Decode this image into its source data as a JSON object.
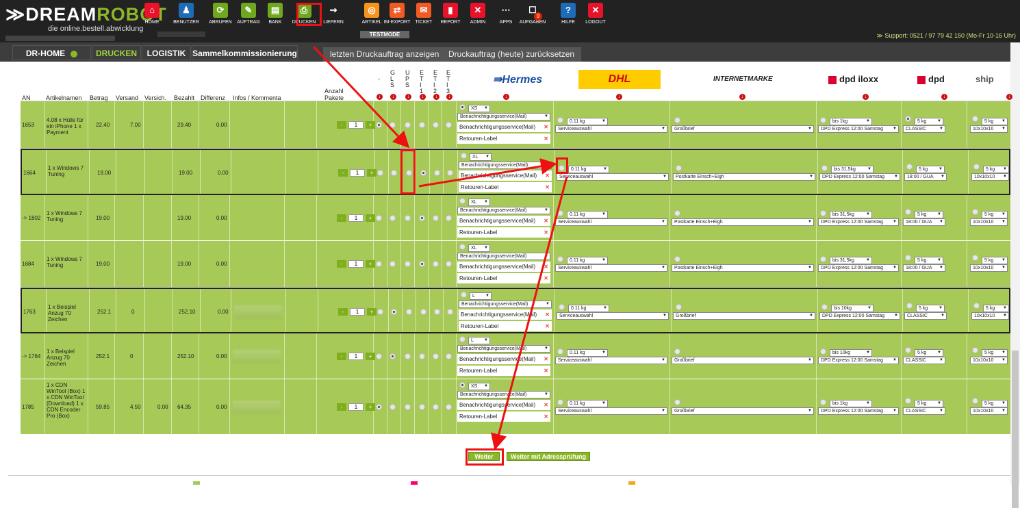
{
  "app": {
    "logo_prefix": "≫",
    "logo_name_a": "DREAM",
    "logo_name_b": "ROBOT",
    "logo_sub": "die online.bestell.abwicklung",
    "testmode": "TESTMODE",
    "support": "≫ Support: 0521 / 97 79 42 150 (Mo-Fr 10-16 Uhr)"
  },
  "nav": [
    {
      "label": "HOME",
      "icon": "house-icon",
      "color": "#e8132a",
      "glyph": "⌂"
    },
    {
      "label": "BENUTZER",
      "icon": "users-icon",
      "color": "#1e6bb8",
      "glyph": "♟"
    },
    {
      "label": "ABRUFEN",
      "icon": "download-icon",
      "color": "#6fa81e",
      "glyph": "⟳"
    },
    {
      "label": "AUFTRAG",
      "icon": "order-icon",
      "color": "#6fa81e",
      "glyph": "✎"
    },
    {
      "label": "BANK",
      "icon": "bank-icon",
      "color": "#6fa81e",
      "glyph": "▤"
    },
    {
      "label": "DRUCKEN",
      "icon": "printer-icon",
      "color": "#6fa81e",
      "glyph": "⎙"
    },
    {
      "label": "LIEFERN",
      "icon": "delivery-icon",
      "color": "#222",
      "glyph": "⇝"
    },
    {
      "label": "ARTIKEL",
      "icon": "article-icon",
      "color": "#f7941d",
      "glyph": "◎"
    },
    {
      "label": "IM-EXPORT",
      "icon": "import-export-icon",
      "color": "#f15a24",
      "glyph": "⇄"
    },
    {
      "label": "TICKET",
      "icon": "ticket-icon",
      "color": "#f15a24",
      "glyph": "✉"
    },
    {
      "label": "REPORT",
      "icon": "report-icon",
      "color": "#e8132a",
      "glyph": "▮"
    },
    {
      "label": "ADMIN",
      "icon": "admin-icon",
      "color": "#e8132a",
      "glyph": "✕"
    },
    {
      "label": "APPS",
      "icon": "apps-icon",
      "color": "#222",
      "glyph": "⋯"
    },
    {
      "label": "AUFGABEN",
      "icon": "tasks-icon",
      "color": "#222",
      "glyph": "☐",
      "badge": "9"
    },
    {
      "label": "HILFE",
      "icon": "help-icon",
      "color": "#1e6bb8",
      "glyph": "?"
    },
    {
      "label": "LOGOUT",
      "icon": "logout-icon",
      "color": "#e8132a",
      "glyph": "✕"
    }
  ],
  "tabs": {
    "home": "DR-HOME",
    "print": "DRUCKEN",
    "logistics": "LOGISTIK",
    "picking": "Sammelkommissionierung",
    "last_job": "letzten Druckauftrag anzeigen",
    "reset_job": "Druckauftrag (heute) zurücksetzen"
  },
  "headers": {
    "an": "AN",
    "article": "Artikelnamen",
    "amount": "Betrag",
    "shipping": "Versand",
    "insurance": "Versich.",
    "paid": "Bezahlt",
    "diff": "Differenz",
    "info": "Infos / Kommenta",
    "packages_a": "Anzahl",
    "packages_b": "Pakete",
    "c_dash": "-",
    "c_gls": "G\nL\nS",
    "c_ups": "U\nP\nS",
    "c_e1": "E\nT\nI\n1",
    "c_e2": "E\nT\nI\n2",
    "c_e3": "E\nT\nI\n3",
    "hermes": "⇛Hermes",
    "dhl": "DHL",
    "internetmarke": "INTERNETMARKE",
    "dpd_iloxx": "dpd iloxx",
    "dpd": "dpd",
    "ship": "ship"
  },
  "hermes_common": {
    "notify": "Benachrichtigungsservice(Mail)",
    "notify2": "Benachrichtigungsservice(Mail)",
    "retour": "Retouren-Label"
  },
  "dhl_common": {
    "weight": "0.11 kg",
    "service": "Serviceauswahl"
  },
  "rows": [
    {
      "an": "1653",
      "article": "4.08 x Hülle für ein iPhone 1 x Payment",
      "amount": "22.40",
      "shipping": "7.00",
      "insurance": "",
      "paid": "29.40",
      "diff": "0.00",
      "qty": "1",
      "radio": 0,
      "size": "XS",
      "im": "Großbrief",
      "iloxx_w": "bis 1kg",
      "iloxx_s": "DPD Express 12:00 Samstag",
      "dpd_w": "5 kg",
      "dpd_s": "CLASSIC",
      "ship_w": "5 kg",
      "ship_s": "10x10x10"
    },
    {
      "an": "1664",
      "article": "1 x Windows 7 Tuning",
      "amount": "19.00",
      "shipping": "",
      "insurance": "",
      "paid": "19.00",
      "diff": "0.00",
      "qty": "1",
      "radio": 3,
      "size": "XL",
      "im": "Postkarte Einsch+Eigh",
      "iloxx_w": "bis 31,5kg",
      "iloxx_s": "DPD Express 12:00 Samstag",
      "dpd_w": "5 kg",
      "dpd_s": "18:00 / GUA",
      "ship_w": "5 kg",
      "ship_s": "10x10x10"
    },
    {
      "an": "-> 1802",
      "article": "1 x Windows 7 Tuning",
      "amount": "19.00",
      "shipping": "",
      "insurance": "",
      "paid": "19.00",
      "diff": "0.00",
      "qty": "1",
      "radio": 3,
      "size": "XL",
      "im": "Postkarte Einsch+Eigh",
      "iloxx_w": "bis 31,5kg",
      "iloxx_s": "DPD Express 12:00 Samstag",
      "dpd_w": "5 kg",
      "dpd_s": "18:00 / GUA",
      "ship_w": "5 kg",
      "ship_s": "10x10x10"
    },
    {
      "an": "1684",
      "article": "1 x Windows 7 Tuning",
      "amount": "19.00",
      "shipping": "",
      "insurance": "",
      "paid": "19.00",
      "diff": "0.00",
      "qty": "1",
      "radio": 3,
      "size": "XL",
      "im": "Postkarte Einsch+Eigh",
      "iloxx_w": "bis 31,5kg",
      "iloxx_s": "DPD Express 12:00 Samstag",
      "dpd_w": "5 kg",
      "dpd_s": "18:00 / GUA",
      "ship_w": "5 kg",
      "ship_s": "10x10x10"
    },
    {
      "an": "1763",
      "article": "1 x Beispiel Anzug 70 Zeichen",
      "amount": "252.1",
      "shipping": "0",
      "insurance": "",
      "paid": "252.10",
      "diff": "0.00",
      "qty": "1",
      "radio": 1,
      "size": "L",
      "im": "Großbrief",
      "iloxx_w": "bis 10kg",
      "iloxx_s": "DPD Express 12:00 Samstag",
      "dpd_w": "5 kg",
      "dpd_s": "CLASSIC",
      "ship_w": "5 kg",
      "ship_s": "10x10x10"
    },
    {
      "an": "-> 1764",
      "article": "1 x Beispiel Anzug 70 Zeichen",
      "amount": "252.1",
      "shipping": "0",
      "insurance": "",
      "paid": "252.10",
      "diff": "0.00",
      "qty": "1",
      "radio": 1,
      "size": "L",
      "im": "Großbrief",
      "iloxx_w": "bis 10kg",
      "iloxx_s": "DPD Express 12:00 Samstag",
      "dpd_w": "5 kg",
      "dpd_s": "CLASSIC",
      "ship_w": "5 kg",
      "ship_s": "10x10x10"
    },
    {
      "an": "1785",
      "article": "1 x CDN WinTool (Box) 1 x CDN WinTool (Download) 1 x CDN Encoder Pro (Box)",
      "amount": "59.85",
      "shipping": "4.50",
      "insurance": "0.00",
      "paid": "64.35",
      "diff": "0.00",
      "qty": "1",
      "radio": 0,
      "size": "XS",
      "im": "Großbrief",
      "iloxx_w": "bis 1kg",
      "iloxx_s": "DPD Express 12:00 Samstag",
      "dpd_w": "5 kg",
      "dpd_s": "CLASSIC",
      "ship_w": "5 kg",
      "ship_s": "10x10x10"
    }
  ],
  "buttons": {
    "next": "Weiter",
    "next_check": "Weiter mit Adressprüfung"
  }
}
